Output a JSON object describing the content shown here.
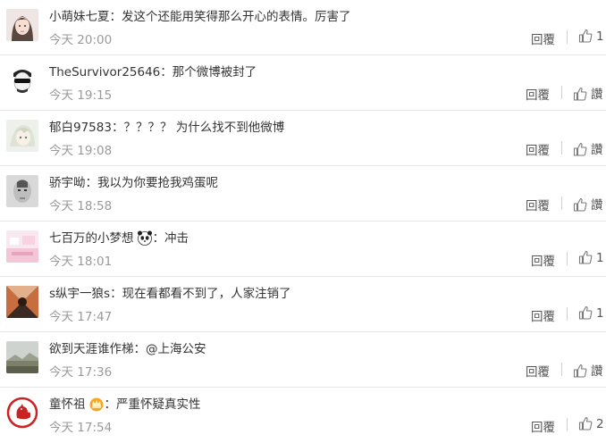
{
  "comments": [
    {
      "user": "小萌妹七夏",
      "badge": "",
      "text": "发这个还能用笑得那么开心的表情。厉害了",
      "time": "今天 20:00",
      "reply": "回覆",
      "like": "1",
      "avatar": "avatar-girl-icon"
    },
    {
      "user": "TheSurvivor25646",
      "badge": "",
      "text": "那个微博被封了",
      "time": "今天 19:15",
      "reply": "回覆",
      "like": "讚",
      "avatar": "avatar-sunglasses-icon"
    },
    {
      "user": "郁白97583",
      "badge": "",
      "text": "？？？？ 为什么找不到他微博",
      "time": "今天 19:08",
      "reply": "回覆",
      "like": "讚",
      "avatar": "avatar-anime-icon"
    },
    {
      "user": "骄宇呦",
      "badge": "",
      "text": "我以为你要抢我鸡蛋呢",
      "time": "今天 18:58",
      "reply": "回覆",
      "like": "讚",
      "avatar": "avatar-sketch-icon"
    },
    {
      "user": "七百万的小梦想",
      "badge": "panda",
      "text": "冲击",
      "time": "今天 18:01",
      "reply": "回覆",
      "like": "1",
      "avatar": "avatar-pink-icon"
    },
    {
      "user": "s纵宇一狼s",
      "badge": "",
      "text": "现在看都看不到了，人家注销了",
      "time": "今天 17:47",
      "reply": "回覆",
      "like": "1",
      "avatar": "avatar-pattern-icon"
    },
    {
      "user": "欲到天涯谁作梯",
      "badge": "",
      "text": "@上海公安",
      "time": "今天 17:36",
      "reply": "回覆",
      "like": "讚",
      "avatar": "avatar-landscape-icon"
    },
    {
      "user": "童怀祖",
      "badge": "crown",
      "text": "严重怀疑真实性",
      "time": "今天 17:54",
      "reply": "回覆",
      "like": "2",
      "avatar": "avatar-rooster-icon"
    }
  ]
}
